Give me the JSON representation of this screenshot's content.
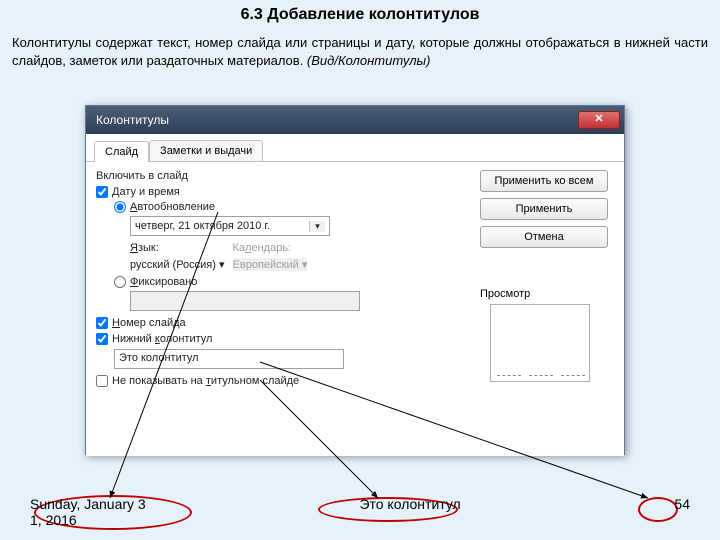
{
  "title": "6.3 Добавление колонтитулов",
  "description": "Колонтитулы содержат текст, номер слайда или страницы и дату, которые должны отображаться в нижней части слайдов, заметок или раздаточных материалов. ",
  "description_em": "(Вид/Колонтитулы)",
  "dialog": {
    "title": "Колонтитулы",
    "tabs": [
      "Слайд",
      "Заметки и выдачи"
    ],
    "section": "Включить в слайд",
    "datetime_label": "Дату и время",
    "auto_label": "Автообновление",
    "date_value": "четверг, 21 октября 2010 г.",
    "lang_label": "Язык:",
    "lang_value": "русский (Россия)",
    "cal_label": "Календарь:",
    "cal_value": "Европейский",
    "fixed_label": "Фиксировано",
    "slideno_label": "Номер слайда",
    "footer_label": "Нижний колонтитул",
    "footer_value": "Это колонтитул",
    "hide_label": "Не показывать на титульном слайде",
    "btn_all": "Применить ко всем",
    "btn_apply": "Применить",
    "btn_cancel": "Отмена",
    "preview_label": "Просмотр"
  },
  "footer": {
    "date": "Sunday, January 3",
    "date2": "1, 2016",
    "center": "Это колонтитул",
    "page": "54"
  }
}
